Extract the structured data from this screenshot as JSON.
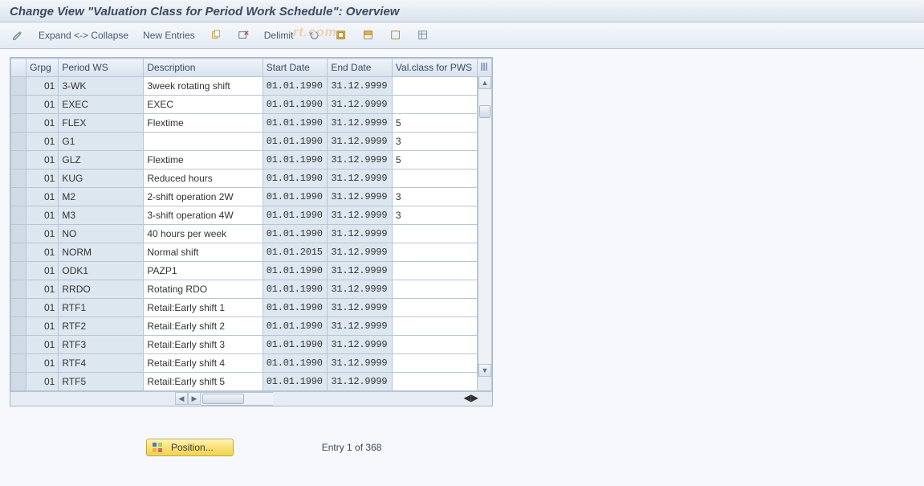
{
  "title": "Change View \"Valuation Class for Period Work Schedule\": Overview",
  "toolbar": {
    "expand_collapse": "Expand <-> Collapse",
    "new_entries": "New Entries",
    "delimit": "Delimit"
  },
  "watermark": "rt.com",
  "table": {
    "headers": {
      "grpg": "Grpg",
      "period_ws": "Period WS",
      "description": "Description",
      "start_date": "Start Date",
      "end_date": "End Date",
      "val_class": "Val.class for PWS"
    },
    "rows": [
      {
        "grpg": "01",
        "pws": "3-WK",
        "desc": "3week rotating shift",
        "start": "01.01.1990",
        "end": "31.12.9999",
        "val": "",
        "req": true
      },
      {
        "grpg": "01",
        "pws": "EXEC",
        "desc": "EXEC",
        "start": "01.01.1990",
        "end": "31.12.9999",
        "val": ""
      },
      {
        "grpg": "01",
        "pws": "FLEX",
        "desc": "Flextime",
        "start": "01.01.1990",
        "end": "31.12.9999",
        "val": "5"
      },
      {
        "grpg": "01",
        "pws": "G1",
        "desc": "",
        "start": "01.01.1990",
        "end": "31.12.9999",
        "val": "3"
      },
      {
        "grpg": "01",
        "pws": "GLZ",
        "desc": "Flextime",
        "start": "01.01.1990",
        "end": "31.12.9999",
        "val": "5"
      },
      {
        "grpg": "01",
        "pws": "KUG",
        "desc": "Reduced hours",
        "start": "01.01.1990",
        "end": "31.12.9999",
        "val": ""
      },
      {
        "grpg": "01",
        "pws": "M2",
        "desc": "2-shift operation 2W",
        "start": "01.01.1990",
        "end": "31.12.9999",
        "val": "3"
      },
      {
        "grpg": "01",
        "pws": "M3",
        "desc": "3-shift operation 4W",
        "start": "01.01.1990",
        "end": "31.12.9999",
        "val": "3"
      },
      {
        "grpg": "01",
        "pws": "NO",
        "desc": "40 hours per week",
        "start": "01.01.1990",
        "end": "31.12.9999",
        "val": ""
      },
      {
        "grpg": "01",
        "pws": "NORM",
        "desc": "Normal shift",
        "start": "01.01.2015",
        "end": "31.12.9999",
        "val": ""
      },
      {
        "grpg": "01",
        "pws": "ODK1",
        "desc": "PAZP1",
        "start": "01.01.1990",
        "end": "31.12.9999",
        "val": ""
      },
      {
        "grpg": "01",
        "pws": "RRDO",
        "desc": "Rotating RDO",
        "start": "01.01.1990",
        "end": "31.12.9999",
        "val": ""
      },
      {
        "grpg": "01",
        "pws": "RTF1",
        "desc": "Retail:Early shift 1",
        "start": "01.01.1990",
        "end": "31.12.9999",
        "val": ""
      },
      {
        "grpg": "01",
        "pws": "RTF2",
        "desc": "Retail:Early shift 2",
        "start": "01.01.1990",
        "end": "31.12.9999",
        "val": ""
      },
      {
        "grpg": "01",
        "pws": "RTF3",
        "desc": "Retail:Early shift 3",
        "start": "01.01.1990",
        "end": "31.12.9999",
        "val": ""
      },
      {
        "grpg": "01",
        "pws": "RTF4",
        "desc": "Retail:Early shift 4",
        "start": "01.01.1990",
        "end": "31.12.9999",
        "val": ""
      },
      {
        "grpg": "01",
        "pws": "RTF5",
        "desc": "Retail:Early shift 5",
        "start": "01.01.1990",
        "end": "31.12.9999",
        "val": ""
      }
    ]
  },
  "footer": {
    "position_label": "Position...",
    "entry_label": "Entry 1 of 368"
  }
}
